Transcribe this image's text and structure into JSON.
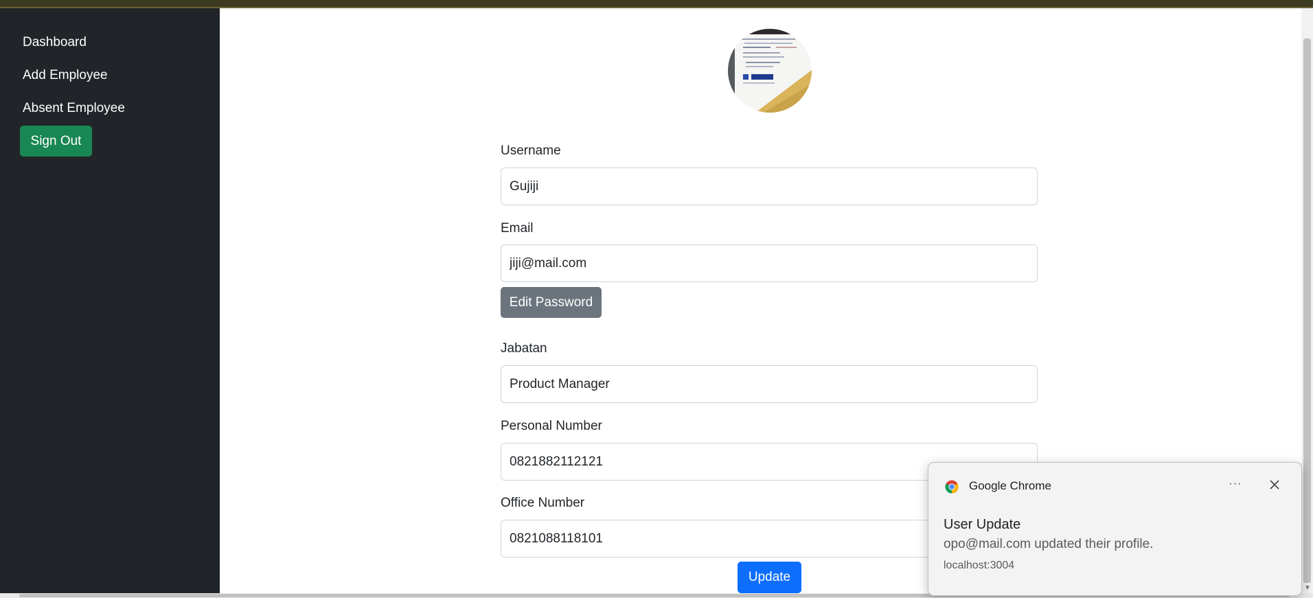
{
  "sidebar": {
    "items": [
      {
        "label": "Dashboard"
      },
      {
        "label": "Add Employee"
      },
      {
        "label": "Absent Employee"
      }
    ],
    "signout_label": "Sign Out"
  },
  "form": {
    "username": {
      "label": "Username",
      "value": "Gujiji"
    },
    "email": {
      "label": "Email",
      "value": "jiji@mail.com"
    },
    "edit_password_label": "Edit Password",
    "jabatan": {
      "label": "Jabatan",
      "value": "Product Manager"
    },
    "personal_number": {
      "label": "Personal Number",
      "value": "0821882112121"
    },
    "office_number": {
      "label": "Office Number",
      "value": "0821088118101"
    },
    "update_label": "Update"
  },
  "notification": {
    "app": "Google Chrome",
    "more": "···",
    "title": "User Update",
    "body": "opo@mail.com updated their profile.",
    "source": "localhost:3004"
  },
  "colors": {
    "sidebar_bg": "#212529",
    "signout": "#198754",
    "edit_password": "#6c757d",
    "update": "#0d6efd"
  }
}
